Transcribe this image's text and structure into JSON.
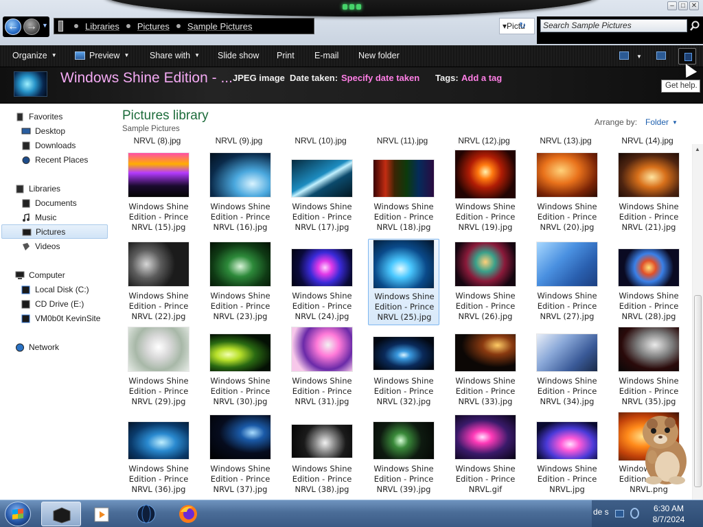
{
  "window": {
    "address_crumbs": [
      "Libraries",
      "Pictures",
      "Sample Pictures"
    ],
    "address_tail": "Pictu",
    "search_placeholder": "Search Sample Pictures",
    "controls": [
      "–",
      "□",
      "✕"
    ]
  },
  "toolbar": {
    "organize": "Organize",
    "preview": "Preview",
    "share_with": "Share with",
    "slide_show": "Slide show",
    "print": "Print",
    "email": "E-mail",
    "new_folder": "New folder"
  },
  "details": {
    "title": "Windows Shine Edition - ...",
    "file_type": "JPEG image",
    "date_label": "Date taken:",
    "date_value": "Specify date taken",
    "tags_label": "Tags:",
    "tags_value": "Add a tag",
    "help_tooltip": "Get help."
  },
  "nav": {
    "favorites": "Favorites",
    "desktop": "Desktop",
    "downloads": "Downloads",
    "recent": "Recent Places",
    "libraries": "Libraries",
    "documents": "Documents",
    "music": "Music",
    "pictures": "Pictures",
    "videos": "Videos",
    "computer": "Computer",
    "local_disk": "Local Disk (C:)",
    "cd_drive": "CD Drive (E:)",
    "vm": "VM0b0t KevinSite",
    "network": "Network"
  },
  "content": {
    "library_title": "Pictures library",
    "library_sub": "Sample Pictures",
    "arrange_label": "Arrange by:",
    "arrange_value": "Folder",
    "top_row": [
      "NRVL (8).jpg",
      "NRVL (9).jpg",
      "NRVL (10).jpg",
      "NRVL (11).jpg",
      "NRVL (12).jpg",
      "NRVL (13).jpg",
      "NRVL (14).jpg"
    ],
    "files": [
      {
        "l1": "Windows Shine",
        "l2": "Edition - Prince",
        "l3": "NRVL (15).jpg"
      },
      {
        "l1": "Windows Shine",
        "l2": "Edition - Prince",
        "l3": "NRVL (16).jpg"
      },
      {
        "l1": "Windows Shine",
        "l2": "Edition - Prince",
        "l3": "NRVL (17).jpg"
      },
      {
        "l1": "Windows Shine",
        "l2": "Edition - Prince",
        "l3": "NRVL (18).jpg"
      },
      {
        "l1": "Windows Shine",
        "l2": "Edition - Prince",
        "l3": "NRVL (19).jpg"
      },
      {
        "l1": "Windows Shine",
        "l2": "Edition - Prince",
        "l3": "NRVL (20).jpg"
      },
      {
        "l1": "Windows Shine",
        "l2": "Edition - Prince",
        "l3": "NRVL (21).jpg"
      },
      {
        "l1": "Windows Shine",
        "l2": "Edition - Prince",
        "l3": "NRVL (22).jpg"
      },
      {
        "l1": "Windows Shine",
        "l2": "Edition - Prince",
        "l3": "NRVL (23).jpg"
      },
      {
        "l1": "Windows Shine",
        "l2": "Edition - Prince",
        "l3": "NRVL (24).jpg"
      },
      {
        "l1": "Windows Shine",
        "l2": "Edition - Prince",
        "l3": "NRVL (25).jpg"
      },
      {
        "l1": "Windows Shine",
        "l2": "Edition - Prince",
        "l3": "NRVL (26).jpg"
      },
      {
        "l1": "Windows Shine",
        "l2": "Edition - Prince",
        "l3": "NRVL (27).jpg"
      },
      {
        "l1": "Windows Shine",
        "l2": "Edition - Prince",
        "l3": "NRVL (28).jpg"
      },
      {
        "l1": "Windows Shine",
        "l2": "Edition - Prince",
        "l3": "NRVL (29).jpg"
      },
      {
        "l1": "Windows Shine",
        "l2": "Edition - Prince",
        "l3": "NRVL (30).jpg"
      },
      {
        "l1": "Windows Shine",
        "l2": "Edition - Prince",
        "l3": "NRVL (31).jpg"
      },
      {
        "l1": "Windows Shine",
        "l2": "Edition - Prince",
        "l3": "NRVL (32).jpg"
      },
      {
        "l1": "Windows Shine",
        "l2": "Edition - Prince",
        "l3": "NRVL (33).jpg"
      },
      {
        "l1": "Windows Shine",
        "l2": "Edition - Prince",
        "l3": "NRVL (34).jpg"
      },
      {
        "l1": "Windows Shine",
        "l2": "Edition - Prince",
        "l3": "NRVL (35).jpg"
      },
      {
        "l1": "Windows Shine",
        "l2": "Edition - Prince",
        "l3": "NRVL (36).jpg"
      },
      {
        "l1": "Windows Shine",
        "l2": "Edition - Prince",
        "l3": "NRVL (37).jpg"
      },
      {
        "l1": "Windows Shine",
        "l2": "Edition - Prince",
        "l3": "NRVL (38).jpg"
      },
      {
        "l1": "Windows Shine",
        "l2": "Edition - Prince",
        "l3": "NRVL (39).jpg"
      },
      {
        "l1": "Windows Shine",
        "l2": "Edition - Prince",
        "l3": "NRVL.gif"
      },
      {
        "l1": "Windows Shine",
        "l2": "Edition - Prince",
        "l3": "NRVL.jpg"
      },
      {
        "l1": "Windows Shine",
        "l2": "Edition - Prince",
        "l3": "NRVL.png"
      }
    ],
    "selected_file": "NRVL (25).jpg"
  },
  "taskbar": {
    "tray_text": "de s",
    "time": "6:30 AM",
    "date": "8/7/2024"
  },
  "colors": {
    "accent_title": "#1d6c3b",
    "link": "#1d5fae",
    "details_title": "#f4aaf4",
    "details_link": "#ff7fe6"
  },
  "icons": [
    "back-arrow-icon",
    "forward-arrow-icon",
    "search-icon",
    "preview-icon",
    "help-icon",
    "star-icon",
    "folder-icon",
    "computer-icon",
    "network-icon",
    "windows-logo-icon",
    "firefox-icon"
  ]
}
